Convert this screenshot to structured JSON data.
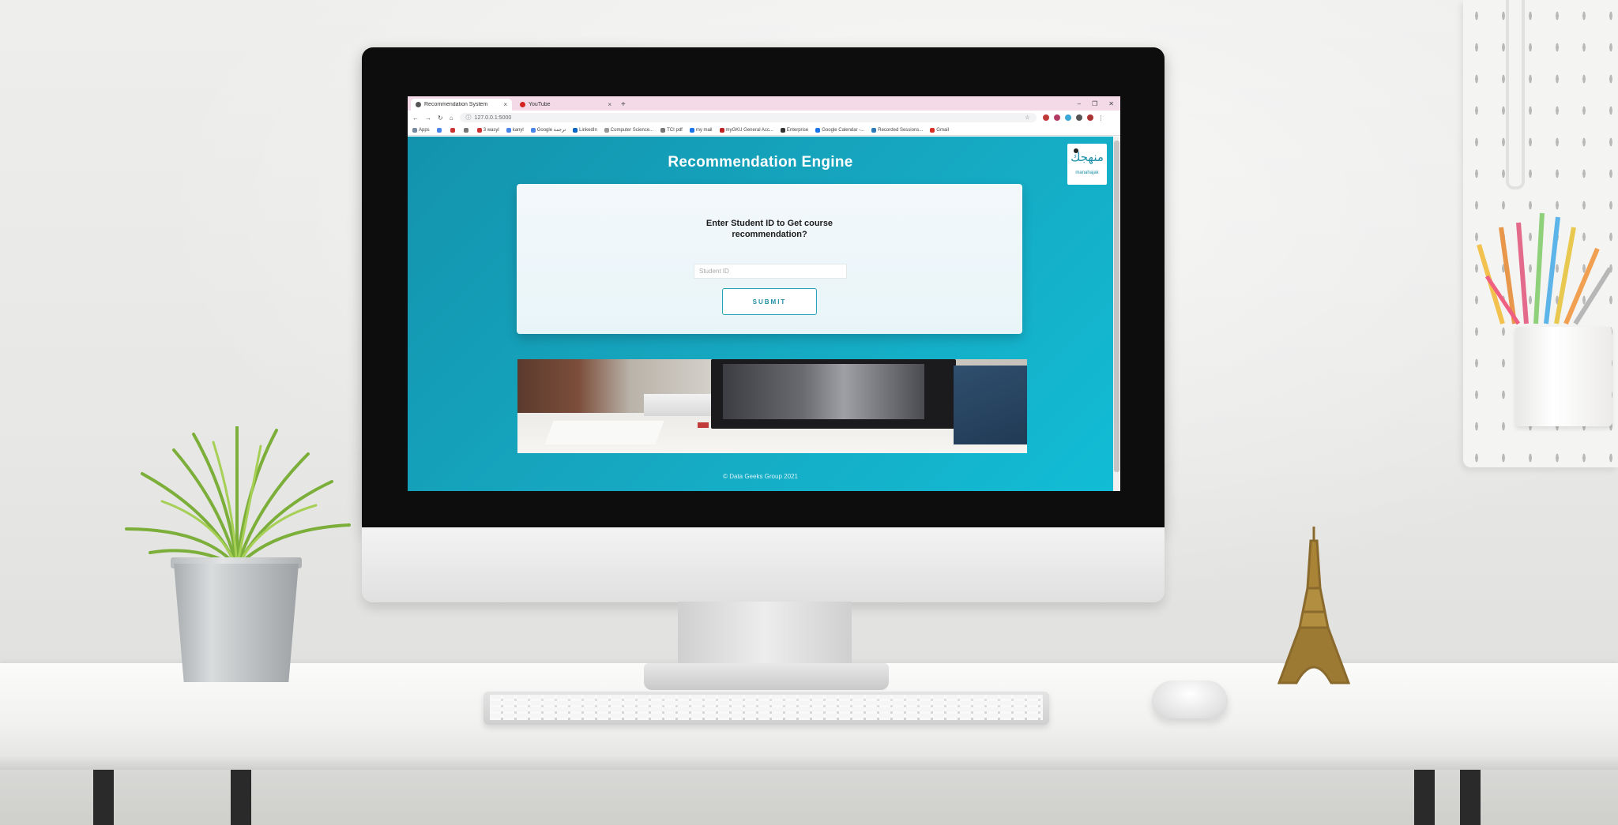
{
  "browser": {
    "tabs": [
      {
        "label": "Recommendation System",
        "active": true
      },
      {
        "label": "YouTube",
        "active": false
      }
    ],
    "new_tab_symbol": "+",
    "close_symbol": "×",
    "window_controls": {
      "minimize": "–",
      "restore": "❐",
      "close": "✕"
    },
    "url": "127.0.0.1:5000",
    "bookmarks": [
      "Apps",
      "",
      "",
      "",
      "3 wasyl",
      "kanyl",
      "Google ترجمة",
      "LinkedIn",
      "Computer Science...",
      "TCI pdf",
      "my mail",
      "myGKU General Acc...",
      "Enterprise",
      "Google Calendar -...",
      "Recorded Sessions...",
      "Gmail"
    ]
  },
  "page": {
    "title": "Recommendation Engine",
    "logo_arabic": "منهجك",
    "logo_text": "manahajak",
    "card": {
      "question": "Enter Student ID to Get course recommendation?",
      "input_placeholder": "Student ID",
      "input_value": "",
      "submit_label": "SUBMIT"
    },
    "footer": "© Data Geeks Group 2021"
  },
  "colors": {
    "page_gradient_start": "#1393ad",
    "page_gradient_end": "#12bcd5",
    "tab_strip": "#f4d9e7",
    "button_border": "#29a3b9"
  },
  "icons": [
    "back-arrow-icon",
    "forward-arrow-icon",
    "reload-icon",
    "home-icon",
    "info-icon",
    "star-icon",
    "close-icon",
    "extension-icon",
    "menu-dots-icon"
  ]
}
